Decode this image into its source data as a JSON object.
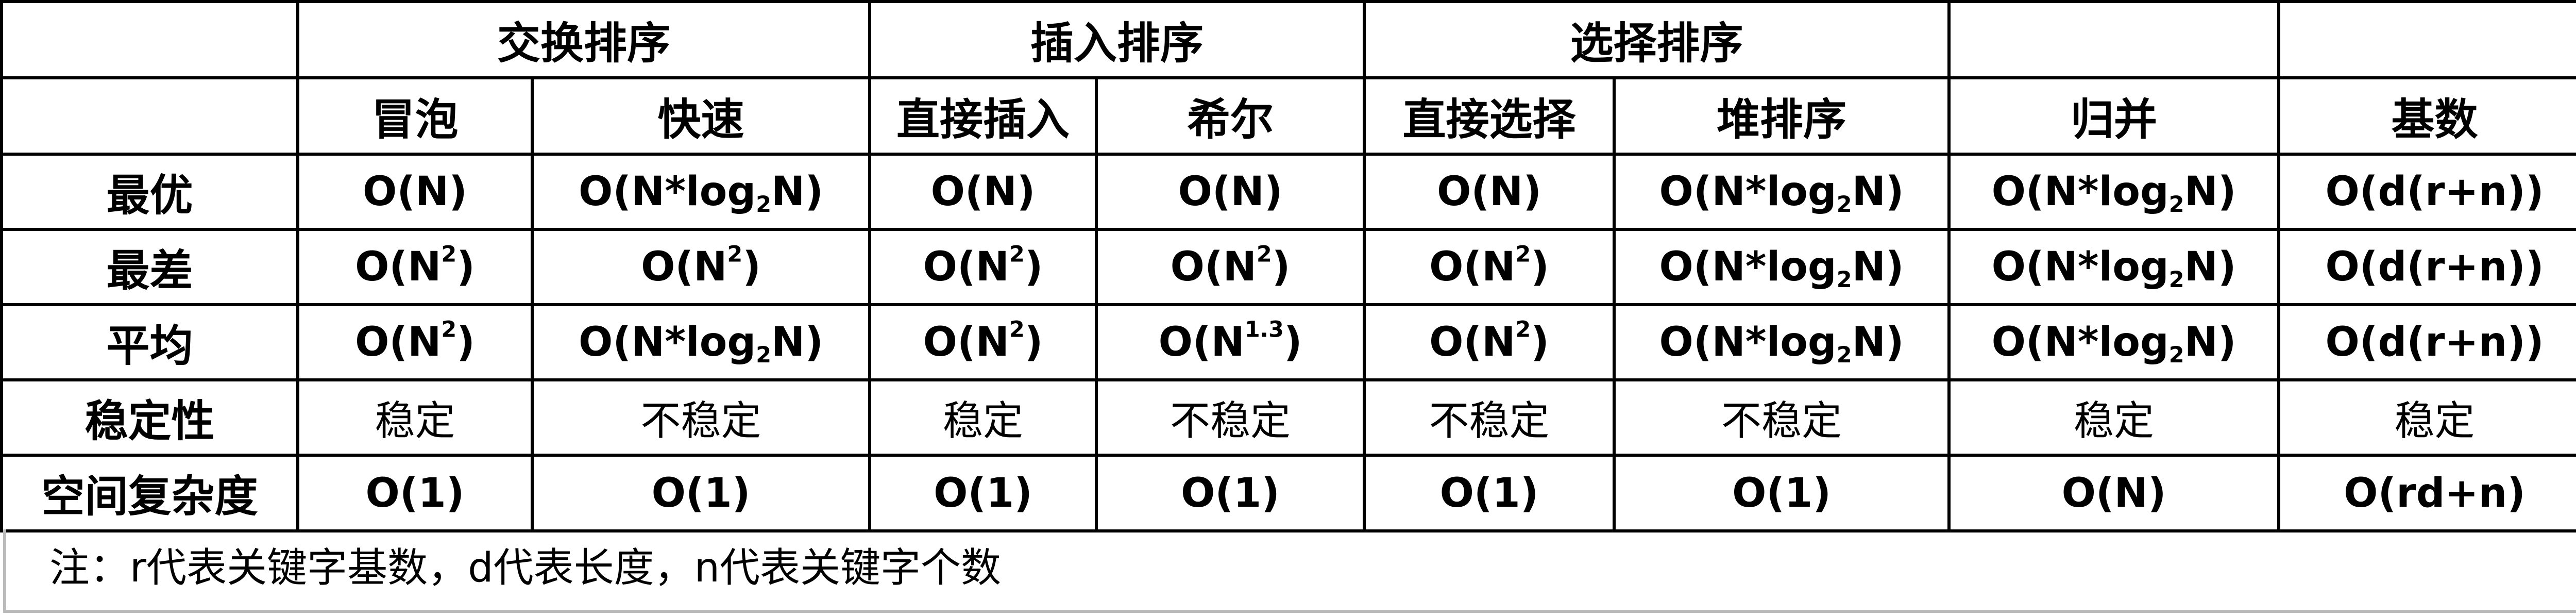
{
  "groups": [
    "交换排序",
    "插入排序",
    "选择排序"
  ],
  "algorithms": [
    "冒泡",
    "快速",
    "直接插入",
    "希尔",
    "直接选择",
    "堆排序",
    "归并",
    "基数"
  ],
  "row_headers": {
    "best": "最优",
    "worst": "最差",
    "average": "平均",
    "stability": "稳定性",
    "space": "空间复杂度"
  },
  "best": [
    "O(N)",
    "O(N*log2N)",
    "O(N)",
    "O(N)",
    "O(N)",
    "O(N*log2N)",
    "O(N*log2N)",
    "O(d(r+n))"
  ],
  "worst": [
    "O(N2)",
    "O(N2)",
    "O(N2)",
    "O(N2)",
    "O(N2)",
    "O(N*log2N)",
    "O(N*log2N)",
    "O(d(r+n))"
  ],
  "average": [
    "O(N2)",
    "O(N*log2N)",
    "O(N2)",
    "O(N1.3)",
    "O(N2)",
    "O(N*log2N)",
    "O(N*log2N)",
    "O(d(r+n))"
  ],
  "stability": [
    "稳定",
    "不稳定",
    "稳定",
    "不稳定",
    "不稳定",
    "不稳定",
    "稳定",
    "稳定"
  ],
  "space": [
    "O(1)",
    "O(1)",
    "O(1)",
    "O(1)",
    "O(1)",
    "O(1)",
    "O(N)",
    "O(rd+n)"
  ],
  "note": "注：r代表关键字基数，d代表长度，n代表关键字个数"
}
